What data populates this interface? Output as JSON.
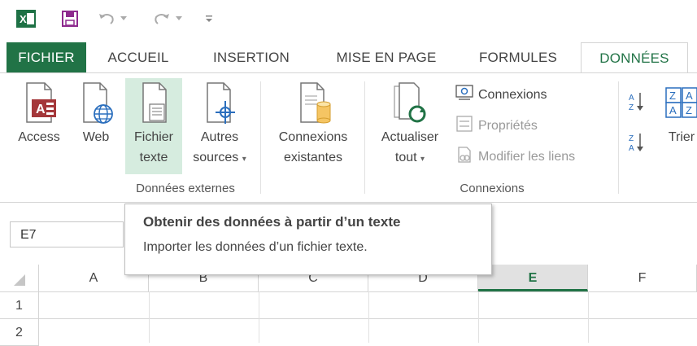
{
  "app": {
    "title": ""
  },
  "colors": {
    "accent": "#217346",
    "selected_bg": "#d6ecdf",
    "access_red": "#a4373a"
  },
  "qat": {
    "icons": [
      "excel-logo-icon",
      "save-icon",
      "undo-icon",
      "redo-icon",
      "customize-qat-icon"
    ]
  },
  "tabs": [
    {
      "label": "FICHIER"
    },
    {
      "label": "ACCUEIL"
    },
    {
      "label": "INSERTION"
    },
    {
      "label": "MISE EN PAGE"
    },
    {
      "label": "FORMULES"
    },
    {
      "label": "DONNÉES"
    }
  ],
  "ribbon": {
    "external": {
      "group_label": "Données externes",
      "access": "Access",
      "web": "Web",
      "text_line1": "Fichier",
      "text_line2": "texte",
      "other_line1": "Autres",
      "other_line2": "sources",
      "conn_line1": "Connexions",
      "conn_line2": "existantes"
    },
    "connections": {
      "group_label": "Connexions",
      "refresh_line1": "Actualiser",
      "refresh_line2": "tout",
      "connections": "Connexions",
      "properties": "Propriétés",
      "edit_links": "Modifier les liens"
    },
    "sort": {
      "sort_label": "Trier"
    }
  },
  "formula_bar": {
    "name_box": "E7"
  },
  "tooltip": {
    "title": "Obtenir des données à partir d’un texte",
    "description": "Importer les données d’un fichier texte."
  },
  "grid": {
    "columns": [
      "A",
      "B",
      "C",
      "D",
      "E",
      "F"
    ],
    "rows": [
      "1",
      "2"
    ],
    "selected_column": "E"
  }
}
